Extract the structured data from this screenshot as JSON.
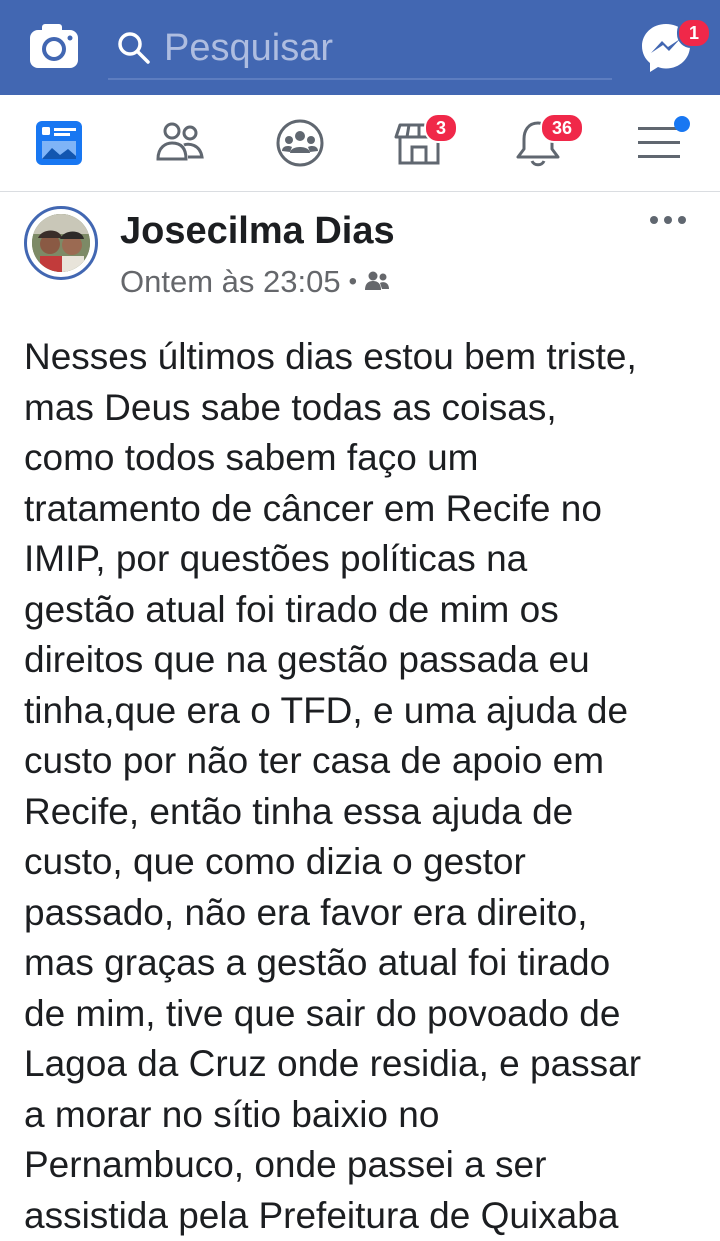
{
  "search": {
    "placeholder": "Pesquisar"
  },
  "badges": {
    "messenger": "1",
    "marketplace": "3",
    "notifications": "36"
  },
  "post": {
    "author": "Josecilma Dias",
    "timestamp": "Ontem às 23:05",
    "separator": "•",
    "audience_icon": "friends-icon",
    "text_lines": [
      "Nesses últimos dias estou bem triste,",
      "mas Deus sabe todas as coisas,",
      "como todos sabem faço um",
      "tratamento de câncer em Recife no",
      "IMIP, por questões políticas na",
      "gestão atual foi tirado de mim os",
      "direitos que na gestão passada eu",
      "tinha,que era o TFD, e uma ajuda de",
      "custo por não ter casa de apoio em",
      "Recife, então tinha essa ajuda de",
      "custo, que como dizia o gestor",
      "passado, não era favor era direito,",
      "mas graças a gestão atual foi tirado",
      "de mim, tive que sair do povoado de",
      "Lagoa da Cruz onde residia, e passar",
      "a morar no sítio baixio no",
      "Pernambuco, onde passei a ser",
      "assistida pela Prefeitura de Quixaba"
    ]
  },
  "colors": {
    "brand": "#4267b2",
    "badge": "#f02849",
    "text": "#1c1e21",
    "muted": "#65676b"
  }
}
